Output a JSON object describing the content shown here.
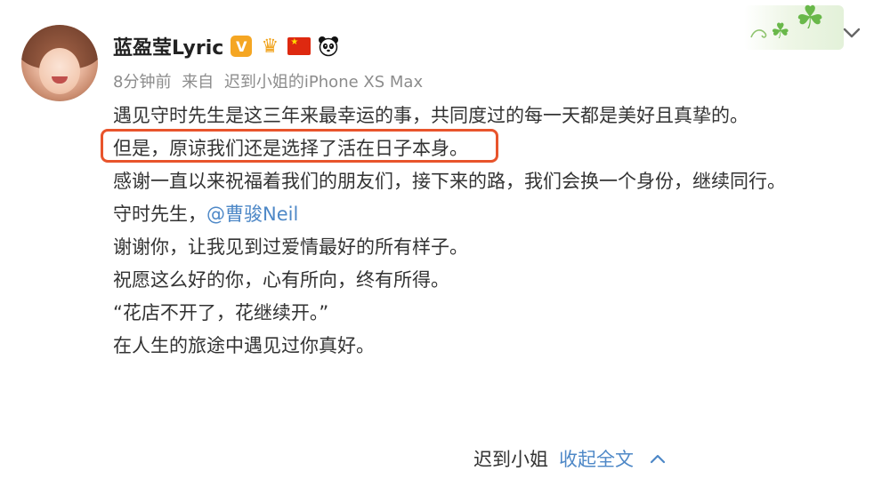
{
  "post": {
    "author": {
      "name": "蓝盈莹Lyric",
      "badges": [
        "verified-v-icon",
        "crown-icon",
        "china-flag-icon",
        "panda-icon"
      ],
      "verified_label": "V"
    },
    "meta": {
      "time": "8分钟前",
      "from_prefix": "来自",
      "device": "迟到小姐的iPhone XS Max"
    },
    "content": {
      "line1": "遇见守时先生是这三年来最幸运的事，共同度过的每一天都是美好且真挚的。",
      "line2": "但是，原谅我们还是选择了活在日子本身。",
      "line3": "感谢一直以来祝福着我们的朋友们，接下来的路，我们会换一个身份，继续同行。",
      "line4_prefix": "守时先生，",
      "line4_mention": "@曹骏Neil",
      "line5": "谢谢你，让我见到过爱情最好的所有样子。",
      "line6": "祝愿这么好的你，心有所向，终有所得。",
      "line7": "“花店不开了，花继续开。”",
      "line8": "在人生的旅途中遇见过你真好。"
    },
    "footer": {
      "author_short": "迟到小姐",
      "collapse_label": "收起全文"
    }
  },
  "colors": {
    "link": "#4e88c7",
    "highlight": "#e8542c",
    "meta": "#8c8c8c",
    "text": "#333333"
  }
}
